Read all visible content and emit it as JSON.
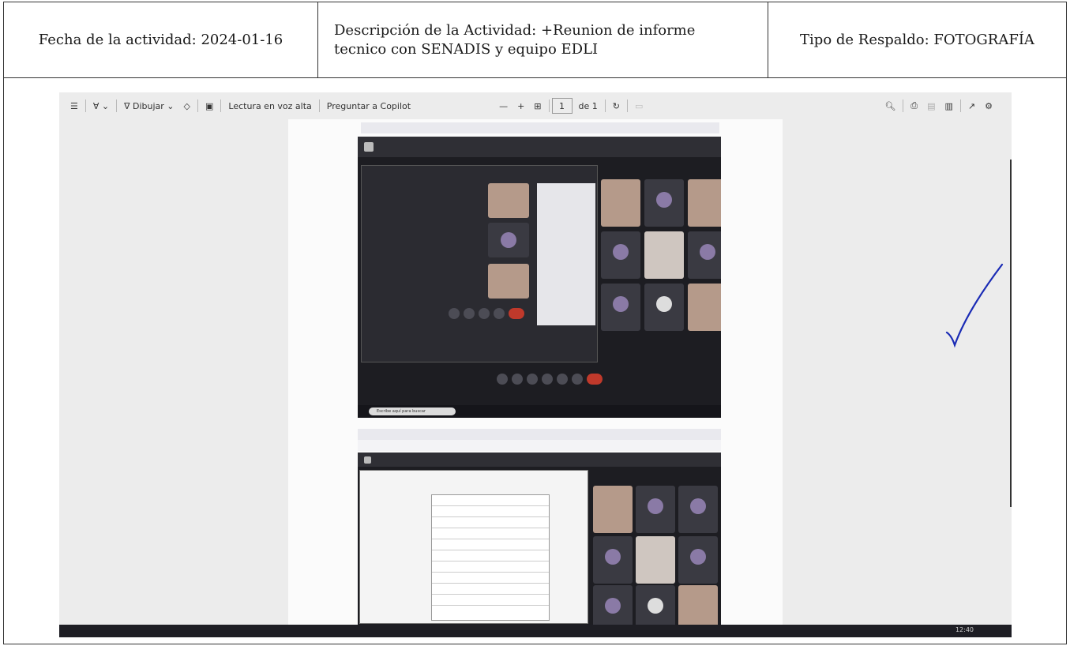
{
  "header": {
    "fecha": "Fecha de la actividad: 2024-01-16",
    "descripcion_line1": "Descripción de la Actividad: +Reunion de informe",
    "descripcion_line2": "tecnico con SENADIS y equipo EDLI",
    "tipo": "Tipo de Respaldo: FOTOGRAFÍA"
  },
  "toolbar": {
    "draw_label": "Dibujar",
    "read_aloud_label": "Lectura en voz alta",
    "copilot_label": "Preguntar a Copilot",
    "minus_label": "—",
    "plus_label": "+",
    "page_number": "1",
    "page_total": "de 1"
  },
  "screen": {
    "taskbar_search": "Escribe aquí para buscar",
    "clock": "12:40"
  },
  "colors": {
    "border": "#333333",
    "checkmark": "#1a2bb5",
    "viewer_bg": "#ececec"
  },
  "icons": [
    "list-icon",
    "highlight-icon",
    "draw-icon",
    "eraser-icon",
    "text-box-icon",
    "fit-page-icon",
    "rotate-icon",
    "search-icon",
    "print-icon",
    "save-icon",
    "save-as-icon",
    "expand-icon",
    "settings-icon",
    "checkmark"
  ]
}
